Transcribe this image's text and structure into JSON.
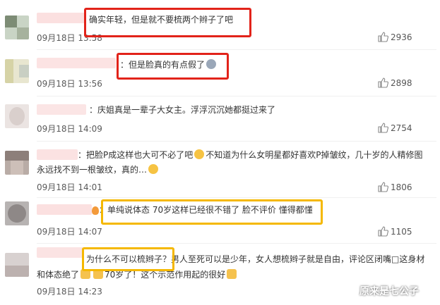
{
  "comments": [
    {
      "text": "确实年轻，但是就不要梳两个辫子了吧",
      "time": "09月18日 13:58",
      "likes": "2936"
    },
    {
      "text": "：但是脸真的有点假了",
      "time": "09月18日 13:56",
      "likes": "2898"
    },
    {
      "text": "：庆姐真是一辈子大女主。浮浮沉沉她都挺过来了",
      "time": "09月18日 14:09",
      "likes": "2754"
    },
    {
      "text_line1": "：把脸P成这样也大可不必了吧",
      "text_line1b": "不知道为什么女明星都好喜欢P掉皱纹，几十岁的人精修图",
      "text_line2": "永远找不到一根皱纹，真的…",
      "time": "09月18日 14:01",
      "likes": "1806"
    },
    {
      "text": "：单纯说体态 70岁这样已经很不错了 脸不评价 懂得都懂",
      "time": "09月18日 14:07",
      "likes": "1105"
    },
    {
      "text_line1a": "为什么不可以梳辫子？",
      "text_line1b": "男人至死可以是少年，女人想梳辫子就是自由，评论区闭嘴□这身材",
      "text_line2a": "和体态绝了",
      "text_line2b": "70岁了！这个示范作用起的很好",
      "time": "09月18日 14:23"
    }
  ],
  "watermark": "原来是七公子",
  "icons": {
    "like": "thumbs-up-icon",
    "emoji": "emoji-icon"
  }
}
